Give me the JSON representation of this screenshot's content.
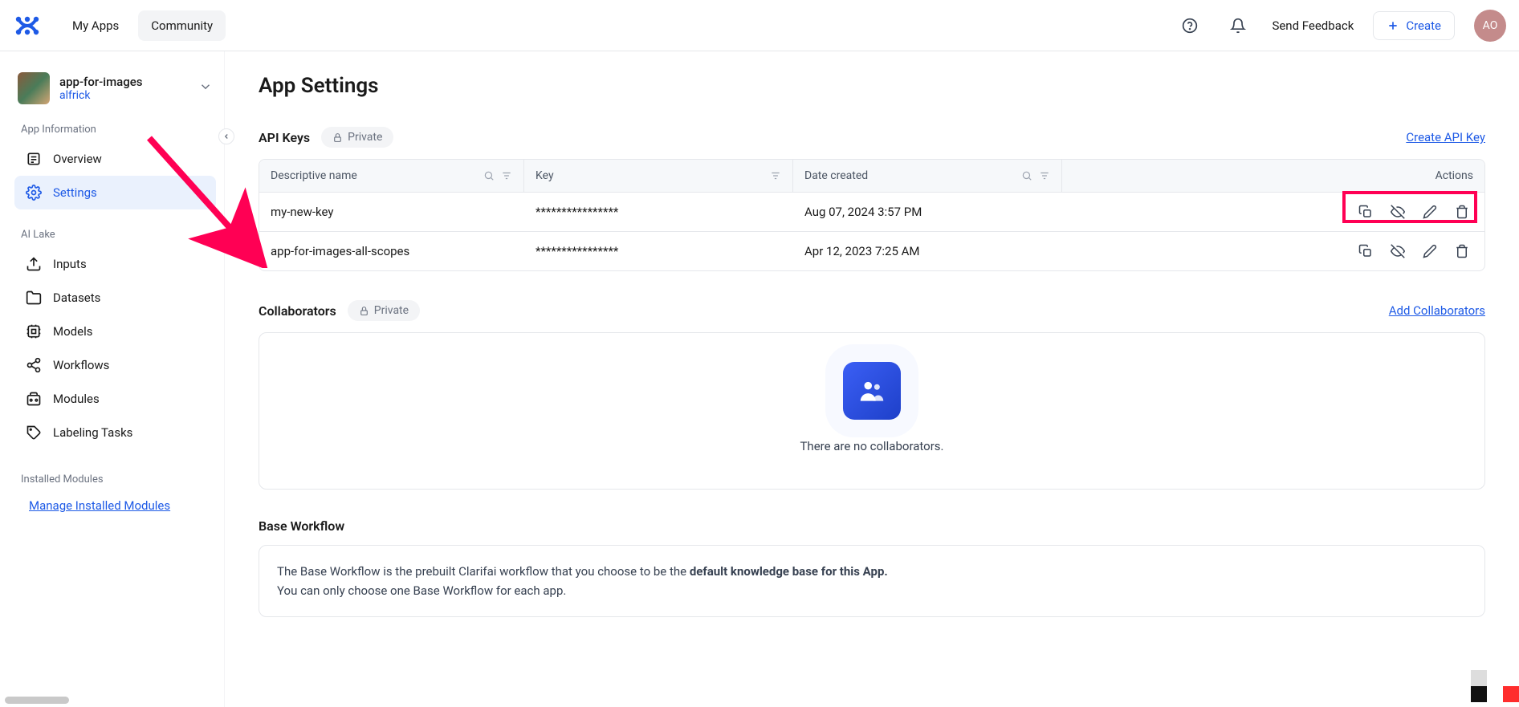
{
  "topbar": {
    "nav": {
      "my_apps": "My Apps",
      "community": "Community"
    },
    "feedback": "Send Feedback",
    "create": "Create",
    "avatar": "AO"
  },
  "sidebar": {
    "app_title": "app-for-images",
    "app_user": "alfrick",
    "sections": {
      "app_info": "App Information",
      "ai_lake": "AI Lake",
      "installed": "Installed Modules"
    },
    "items": {
      "overview": "Overview",
      "settings": "Settings",
      "inputs": "Inputs",
      "datasets": "Datasets",
      "models": "Models",
      "workflows": "Workflows",
      "modules": "Modules",
      "labeling": "Labeling Tasks"
    },
    "manage_link": "Manage Installed Modules"
  },
  "page": {
    "title": "App Settings"
  },
  "apiKeys": {
    "title": "API Keys",
    "private": "Private",
    "create_link": "Create API Key",
    "columns": {
      "name": "Descriptive name",
      "key": "Key",
      "date": "Date created",
      "actions": "Actions"
    },
    "rows": [
      {
        "name": "my-new-key",
        "key": "****************",
        "date": "Aug 07, 2024 3:57 PM"
      },
      {
        "name": "app-for-images-all-scopes",
        "key": "****************",
        "date": "Apr 12, 2023 7:25 AM"
      }
    ]
  },
  "collaborators": {
    "title": "Collaborators",
    "private": "Private",
    "add_link": "Add Collaborators",
    "empty_text": "There are no collaborators."
  },
  "baseWorkflow": {
    "title": "Base Workflow",
    "desc_prefix": "The Base Workflow is the prebuilt Clarifai workflow that you choose to be the ",
    "desc_bold": "default knowledge base for this App.",
    "desc_line2": "You can only choose one Base Workflow for each app."
  }
}
